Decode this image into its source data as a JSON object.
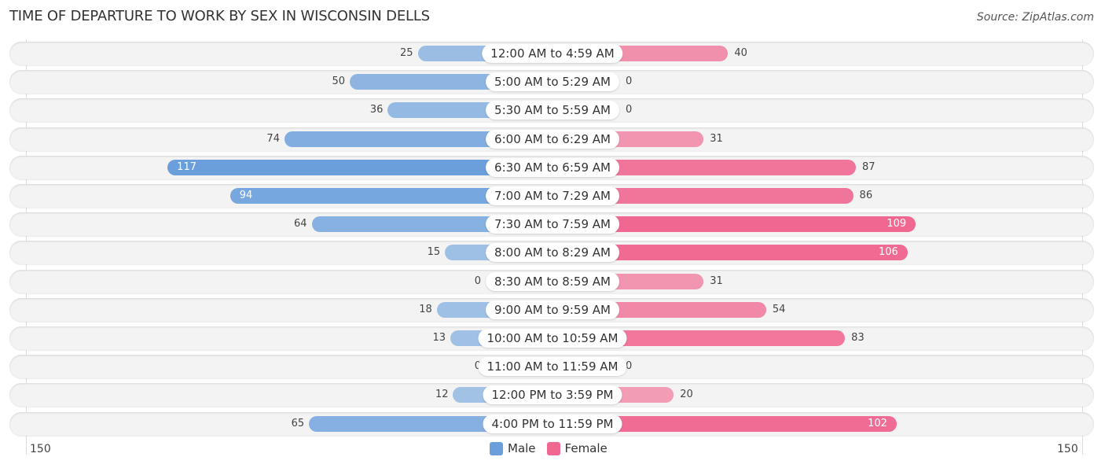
{
  "title": "TIME OF DEPARTURE TO WORK BY SEX IN WISCONSIN DELLS",
  "source": "Source: ZipAtlas.com",
  "colors": {
    "male": "#6a9fdc",
    "female": "#f06891"
  },
  "axis": {
    "left_label": "150",
    "right_label": "150"
  },
  "legend": [
    {
      "label": "Male"
    },
    {
      "label": "Female"
    }
  ],
  "chart_data": {
    "type": "bar",
    "orientation": "horizontal-diverging",
    "title": "TIME OF DEPARTURE TO WORK BY SEX IN WISCONSIN DELLS",
    "categories": [
      "12:00 AM to 4:59 AM",
      "5:00 AM to 5:29 AM",
      "5:30 AM to 5:59 AM",
      "6:00 AM to 6:29 AM",
      "6:30 AM to 6:59 AM",
      "7:00 AM to 7:29 AM",
      "7:30 AM to 7:59 AM",
      "8:00 AM to 8:29 AM",
      "8:30 AM to 8:59 AM",
      "9:00 AM to 9:59 AM",
      "10:00 AM to 10:59 AM",
      "11:00 AM to 11:59 AM",
      "12:00 PM to 3:59 PM",
      "4:00 PM to 11:59 PM"
    ],
    "series": [
      {
        "name": "Male",
        "values": [
          25,
          50,
          36,
          74,
          117,
          94,
          64,
          15,
          0,
          18,
          13,
          0,
          12,
          65
        ]
      },
      {
        "name": "Female",
        "values": [
          40,
          0,
          0,
          31,
          87,
          86,
          109,
          106,
          31,
          54,
          83,
          0,
          20,
          102
        ]
      }
    ],
    "xlim": [
      150,
      150
    ],
    "legend_position": "bottom-center"
  }
}
